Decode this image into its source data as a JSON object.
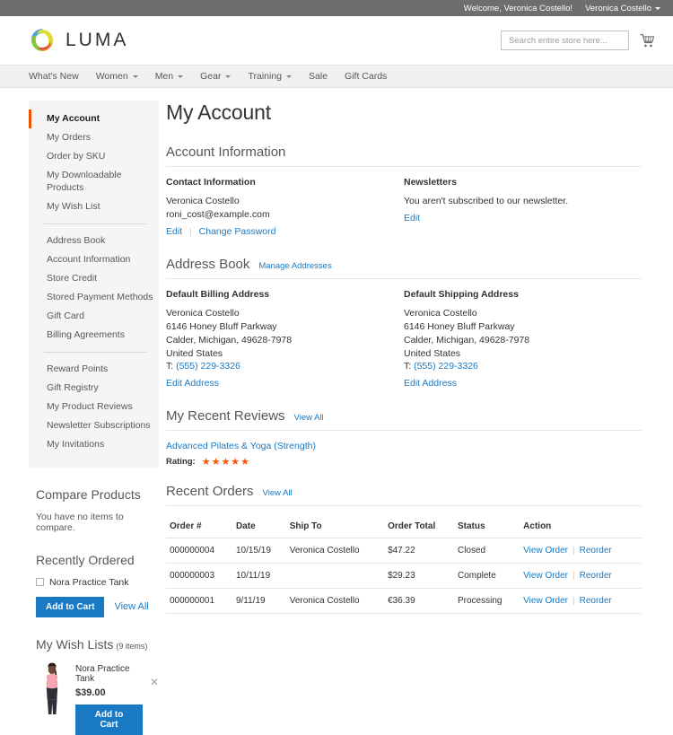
{
  "topbar": {
    "welcome": "Welcome, Veronica Costello!",
    "account_name": "Veronica Costello",
    "caret_icon": "chevron-down-icon"
  },
  "header": {
    "logo_text": "LUMA",
    "logo_icon": "luma-logo-icon",
    "search_placeholder": "Search entire store here...",
    "search_value": "",
    "search_icon": "search-icon",
    "cart_icon": "cart-icon"
  },
  "nav": {
    "items": [
      {
        "label": "What's New",
        "has_caret": false
      },
      {
        "label": "Women",
        "has_caret": true
      },
      {
        "label": "Men",
        "has_caret": true
      },
      {
        "label": "Gear",
        "has_caret": true
      },
      {
        "label": "Training",
        "has_caret": true
      },
      {
        "label": "Sale",
        "has_caret": false
      },
      {
        "label": "Gift Cards",
        "has_caret": false
      }
    ]
  },
  "sidebar": {
    "nav_groups": [
      [
        {
          "label": "My Account",
          "active": true
        },
        {
          "label": "My Orders",
          "active": false
        },
        {
          "label": "Order by SKU",
          "active": false
        },
        {
          "label": "My Downloadable Products",
          "active": false
        },
        {
          "label": "My Wish List",
          "active": false
        }
      ],
      [
        {
          "label": "Address Book",
          "active": false
        },
        {
          "label": "Account Information",
          "active": false
        },
        {
          "label": "Store Credit",
          "active": false
        },
        {
          "label": "Stored Payment Methods",
          "active": false
        },
        {
          "label": "Gift Card",
          "active": false
        },
        {
          "label": "Billing Agreements",
          "active": false
        }
      ],
      [
        {
          "label": "Reward Points",
          "active": false
        },
        {
          "label": "Gift Registry",
          "active": false
        },
        {
          "label": "My Product Reviews",
          "active": false
        },
        {
          "label": "Newsletter Subscriptions",
          "active": false
        },
        {
          "label": "My Invitations",
          "active": false
        }
      ]
    ],
    "compare": {
      "title": "Compare Products",
      "empty_text": "You have no items to compare."
    },
    "recently_ordered": {
      "title": "Recently Ordered",
      "item_label": "Nora Practice Tank",
      "add_to_cart_label": "Add to Cart",
      "view_all_label": "View All"
    },
    "wish_lists": {
      "title": "My Wish Lists",
      "count_label": "(9 items)",
      "item_name": "Nora Practice Tank",
      "item_price": "$39.00",
      "add_to_cart_label": "Add to Cart",
      "remove_icon": "close-icon"
    }
  },
  "main": {
    "page_title": "My Account",
    "account_information": {
      "heading": "Account Information",
      "contact": {
        "title": "Contact Information",
        "name": "Veronica Costello",
        "email": "roni_cost@example.com",
        "edit_label": "Edit",
        "change_password_label": "Change Password"
      },
      "newsletters": {
        "title": "Newsletters",
        "status_text": "You aren't subscribed to our newsletter.",
        "edit_label": "Edit"
      }
    },
    "address_book": {
      "heading": "Address Book",
      "manage_label": "Manage Addresses",
      "billing": {
        "title": "Default Billing Address",
        "name": "Veronica Costello",
        "street": "6146 Honey Bluff Parkway",
        "city_state_zip": "Calder, Michigan, 49628-7978",
        "country": "United States",
        "phone_prefix": "T:",
        "phone": "(555) 229-3326",
        "edit_label": "Edit Address"
      },
      "shipping": {
        "title": "Default Shipping Address",
        "name": "Veronica Costello",
        "street": "6146 Honey Bluff Parkway",
        "city_state_zip": "Calder, Michigan, 49628-7978",
        "country": "United States",
        "phone_prefix": "T:",
        "phone": "(555) 229-3326",
        "edit_label": "Edit Address"
      }
    },
    "recent_reviews": {
      "heading": "My Recent Reviews",
      "view_all_label": "View All",
      "product_name": "Advanced Pilates & Yoga (Strength)",
      "rating_label": "Rating:",
      "stars": "★★★★★",
      "stars_count": 5
    },
    "recent_orders": {
      "heading": "Recent Orders",
      "view_all_label": "View All",
      "columns": [
        "Order #",
        "Date",
        "Ship To",
        "Order Total",
        "Status",
        "Action"
      ],
      "rows": [
        {
          "order": "000000004",
          "date": "10/15/19",
          "ship_to": "Veronica Costello",
          "total": "$47.22",
          "status": "Closed",
          "view_label": "View Order",
          "reorder_label": "Reorder"
        },
        {
          "order": "000000003",
          "date": "10/11/19",
          "ship_to": "",
          "total": "$29.23",
          "status": "Complete",
          "view_label": "View Order",
          "reorder_label": "Reorder"
        },
        {
          "order": "000000001",
          "date": "9/11/19",
          "ship_to": "Veronica Costello",
          "total": "€36.39",
          "status": "Processing",
          "view_label": "View Order",
          "reorder_label": "Reorder"
        }
      ]
    }
  },
  "colors": {
    "accent_orange": "#eb5202",
    "link_blue": "#1979c3",
    "star_orange": "#ff5501",
    "topbar_gray": "#6e6e6e",
    "nav_gray": "#f0f0f0"
  }
}
